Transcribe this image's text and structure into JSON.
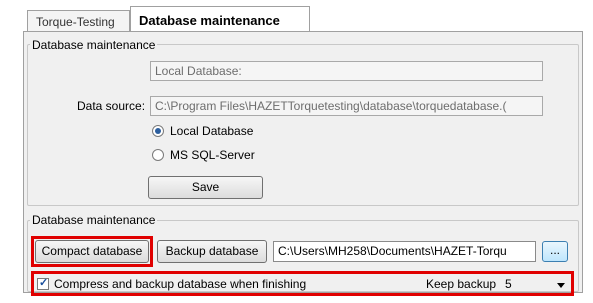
{
  "tabs": [
    {
      "label": "Torque-Testing",
      "active": false
    },
    {
      "label": "Database maintenance",
      "active": true
    }
  ],
  "settings_group": {
    "legend": "Database maintenance",
    "local_db_field": "Local Database:",
    "data_source_label": "Data source:",
    "data_source_value": "C:\\Program Files\\HAZETTorquetesting\\database\\torquedatabase.(",
    "radio_options": [
      {
        "label": "Local Database",
        "selected": true
      },
      {
        "label": "MS SQL-Server",
        "selected": false
      }
    ],
    "save_label": "Save"
  },
  "maintenance_group": {
    "legend": "Database maintenance",
    "compact_label": "Compact database",
    "backup_label": "Backup database",
    "backup_path": "C:\\Users\\MH258\\Documents\\HAZET-Torqu",
    "browse_label": "...",
    "compress_checkbox_label": "Compress and backup database when finishing",
    "compress_checked": true,
    "keep_backup_label": "Keep backup",
    "keep_backup_value": "5"
  },
  "colors": {
    "highlight": "#e00000",
    "panel_bg": "#f0f0f0"
  }
}
